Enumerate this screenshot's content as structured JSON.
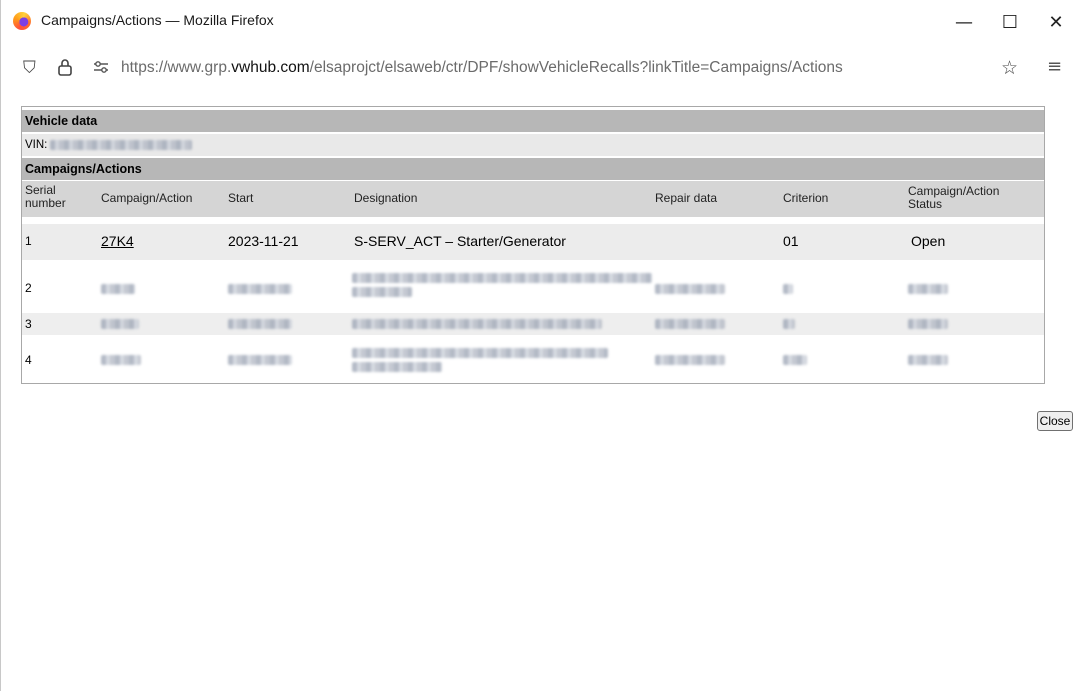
{
  "window": {
    "title": "Campaigns/Actions — Mozilla Firefox",
    "minimize_glyph": "—",
    "maximize_glyph": "☐",
    "close_glyph": "✕"
  },
  "browser": {
    "url_prefix": "https://www.grp.",
    "url_domain": "vwhub.com",
    "url_suffix": "/elsaprojct/elsaweb/ctr/DPF/showVehicleRecalls?linkTitle=Campaigns/Actions",
    "icons": [
      "shield-icon",
      "lock-icon",
      "permissions-icon",
      "bookmark-star-icon",
      "menu-icon"
    ]
  },
  "vehicle": {
    "header": "Vehicle data",
    "vin_label": "VIN:"
  },
  "campaigns": {
    "header": "Campaigns/Actions",
    "columns": {
      "serial": "Serial number",
      "campaign": "Campaign/Action",
      "start": "Start",
      "designation": "Designation",
      "repair": "Repair data",
      "criterion": "Criterion",
      "status": "Campaign/Action Status"
    },
    "rows": [
      {
        "serial": "1",
        "campaign": "27K4",
        "start": "2023-11-21",
        "designation": "S-SERV_ACT – Starter/Generator",
        "repair": "",
        "criterion": "01",
        "status": "Open"
      },
      {
        "serial": "2"
      },
      {
        "serial": "3"
      },
      {
        "serial": "4"
      }
    ]
  },
  "buttons": {
    "close": "Close"
  }
}
